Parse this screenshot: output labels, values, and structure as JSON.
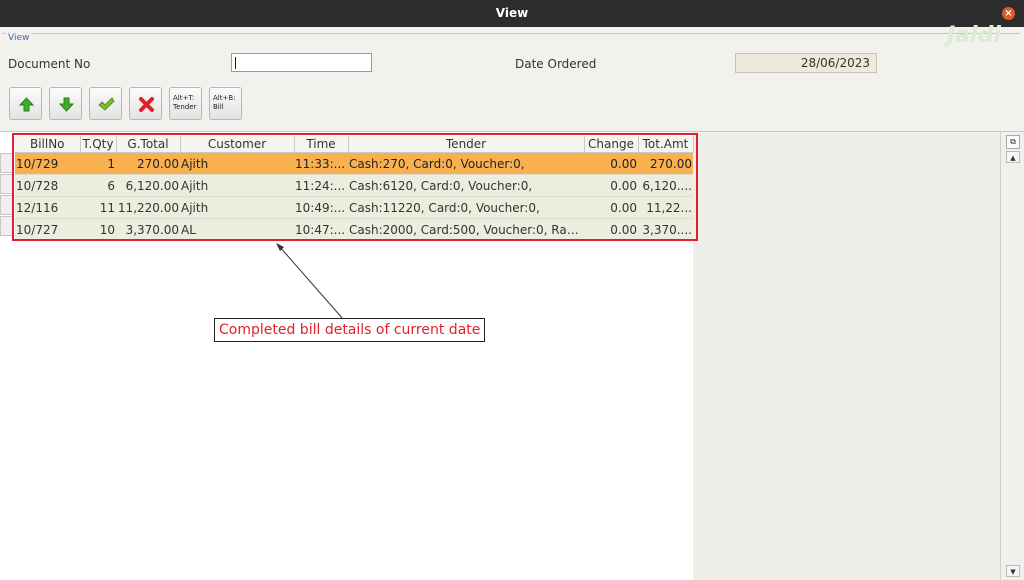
{
  "window": {
    "title": "View"
  },
  "form": {
    "legend": "View",
    "document_no_label": "Document No",
    "document_no_value": "",
    "date_ordered_label": "Date Ordered",
    "date_ordered_value": "28/06/2023"
  },
  "toolbar": {
    "tender_label": "Alt+T:\nTender",
    "bill_label": "Alt+B:\nBill"
  },
  "watermark": "Jaldi",
  "table": {
    "columns": [
      "BillNo",
      "T.Qty",
      "G.Total",
      "Customer",
      "Time",
      "Tender",
      "Change",
      "Tot.Amt"
    ],
    "rows": [
      {
        "bill_no": "10/729",
        "qty": "1",
        "gtotal": "270.00",
        "customer": "Ajith",
        "time": "11:33:...",
        "tender": "Cash:270, Card:0, Voucher:0,",
        "change": "0.00",
        "totamt": "270.00",
        "selected": true
      },
      {
        "bill_no": "10/728",
        "qty": "6",
        "gtotal": "6,120.00",
        "customer": "Ajith",
        "time": "11:24:...",
        "tender": "Cash:6120, Card:0, Voucher:0,",
        "change": "0.00",
        "totamt": "6,120....",
        "selected": false
      },
      {
        "bill_no": "12/116",
        "qty": "11",
        "gtotal": "11,220.00",
        "customer": "Ajith",
        "time": "10:49:...",
        "tender": "Cash:11220, Card:0, Voucher:0,",
        "change": "0.00",
        "totamt": "11,22...",
        "selected": false
      },
      {
        "bill_no": "10/727",
        "qty": "10",
        "gtotal": "3,370.00",
        "customer": "AL",
        "time": "10:47:...",
        "tender": "Cash:2000, Card:500, Voucher:0, Raz...",
        "change": "0.00",
        "totamt": "3,370....",
        "selected": false
      }
    ]
  },
  "annotation": {
    "text": "Completed bill details of current date"
  },
  "colors": {
    "highlight": "#e0202a",
    "selected_row": "#f9b150",
    "row_bg": "#ecedde"
  }
}
